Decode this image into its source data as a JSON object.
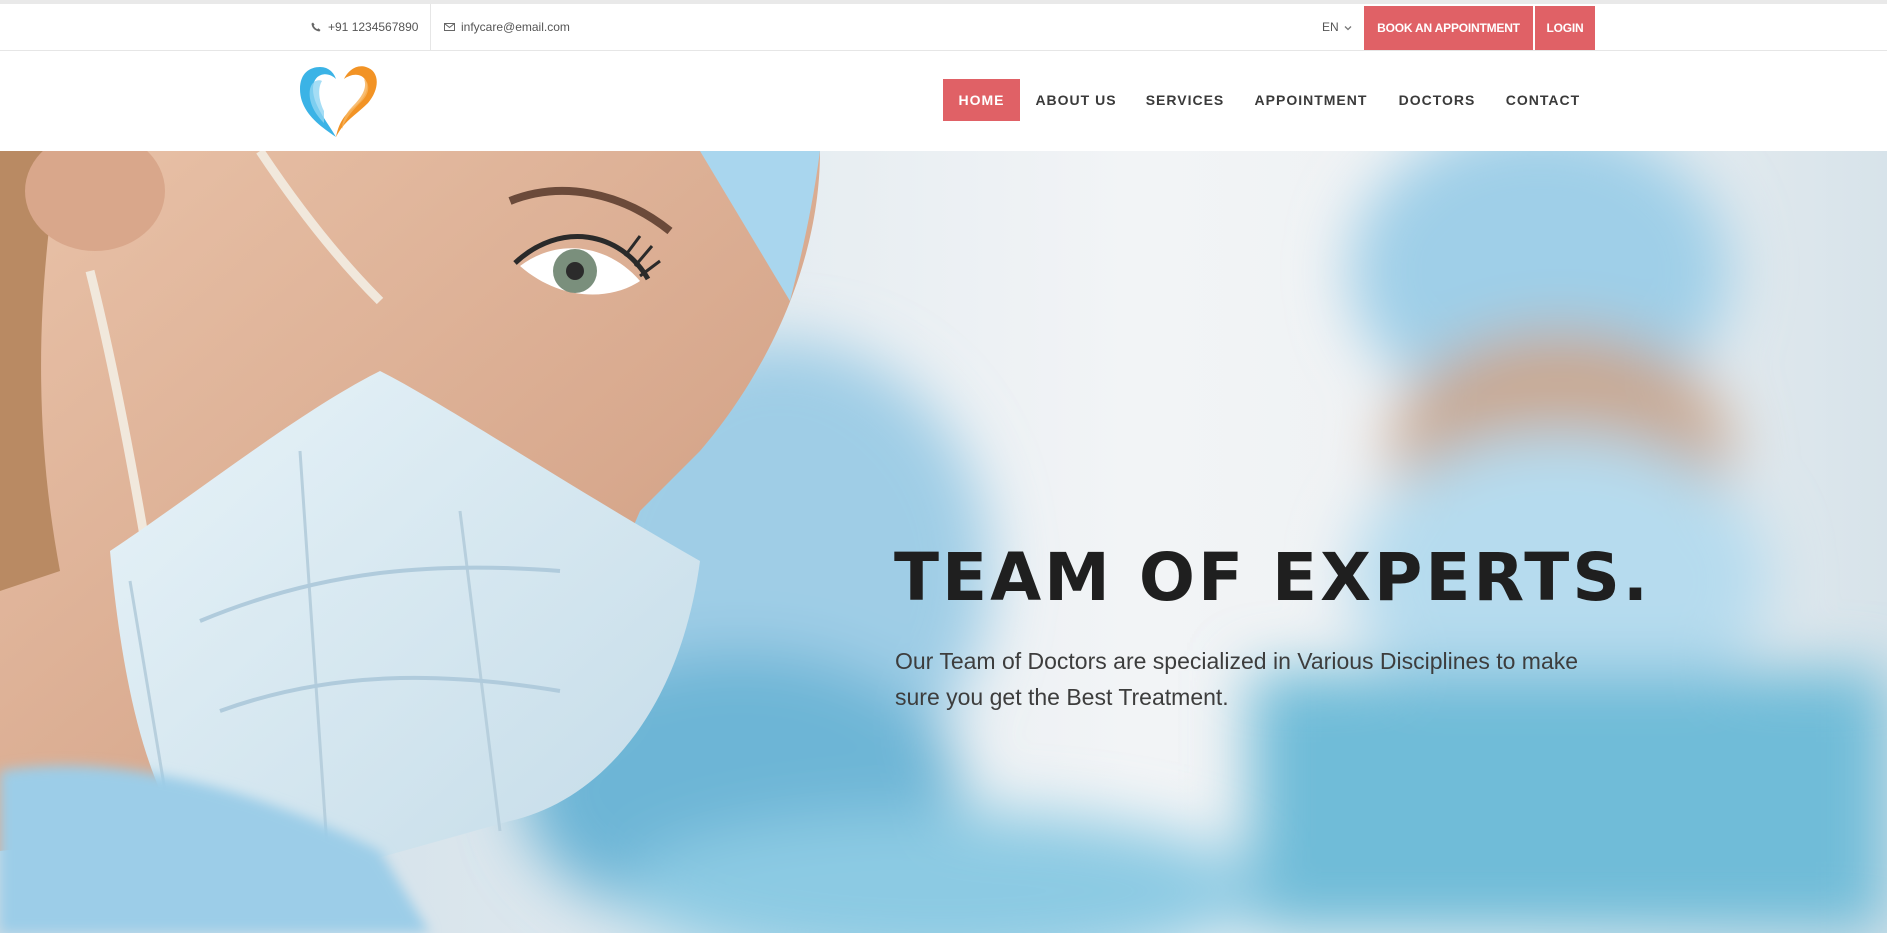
{
  "topbar": {
    "phone": "+91 1234567890",
    "email": "infycare@email.com",
    "language": "EN",
    "book_label": "BOOK AN APPOINTMENT",
    "login_label": "LOGIN",
    "phone_icon": "phone-icon",
    "email_icon": "envelope-icon"
  },
  "nav": {
    "items": [
      {
        "label": "HOME",
        "active": true
      },
      {
        "label": "ABOUT US",
        "active": false
      },
      {
        "label": "SERVICES",
        "active": false
      },
      {
        "label": "APPOINTMENT",
        "active": false
      },
      {
        "label": "DOCTORS",
        "active": false
      },
      {
        "label": "CONTACT",
        "active": false
      }
    ]
  },
  "hero": {
    "title": "TEAM OF EXPERTS.",
    "subtitle": "Our Team of Doctors are specialized in Various Disciplines to make sure you get the Best Treatment."
  },
  "colors": {
    "accent": "#e06166",
    "logo_blue": "#3bb3e6",
    "logo_orange": "#f29325"
  }
}
